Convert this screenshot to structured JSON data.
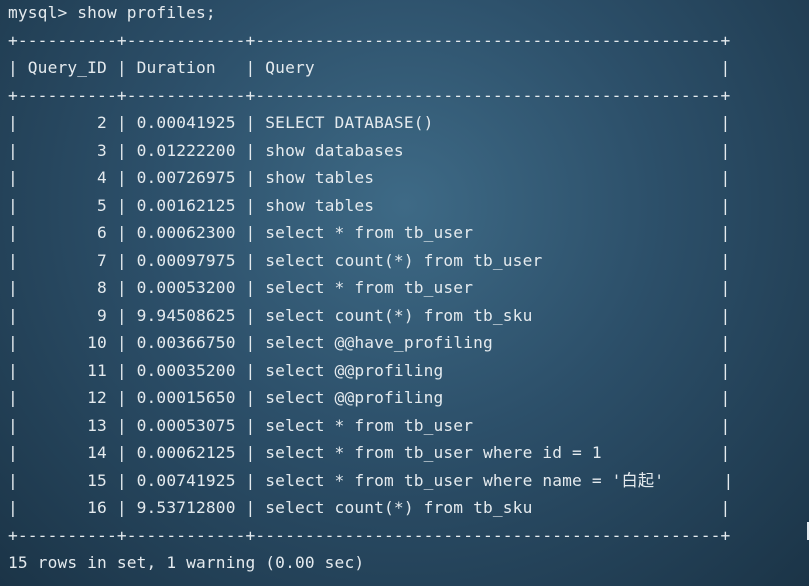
{
  "terminal": {
    "command_line": "mysql> show profiles;",
    "border_line": "+----------+------------+-----------------------------------------------+",
    "header_row": "| Query_ID | Duration   | Query                                         |",
    "rows": [
      "|        2 | 0.00041925 | SELECT DATABASE()                             |",
      "|        3 | 0.01222200 | show databases                                |",
      "|        4 | 0.00726975 | show tables                                   |",
      "|        5 | 0.00162125 | show tables                                   |",
      "|        6 | 0.00062300 | select * from tb_user                         |",
      "|        7 | 0.00097975 | select count(*) from tb_user                  |",
      "|        8 | 0.00053200 | select * from tb_user                         |",
      "|        9 | 9.94508625 | select count(*) from tb_sku                   |",
      "|       10 | 0.00366750 | select @@have_profiling                       |",
      "|       11 | 0.00035200 | select @@profiling                            |",
      "|       12 | 0.00015650 | select @@profiling                            |",
      "|       13 | 0.00053075 | select * from tb_user                         |",
      "|       14 | 0.00062125 | select * from tb_user where id = 1            |",
      "|       15 | 0.00741925 | select * from tb_user where name = '白起'      |",
      "|       16 | 9.53712800 | select count(*) from tb_sku                   |"
    ],
    "summary_line": "15 rows in set, 1 warning (0.00 sec)"
  }
}
